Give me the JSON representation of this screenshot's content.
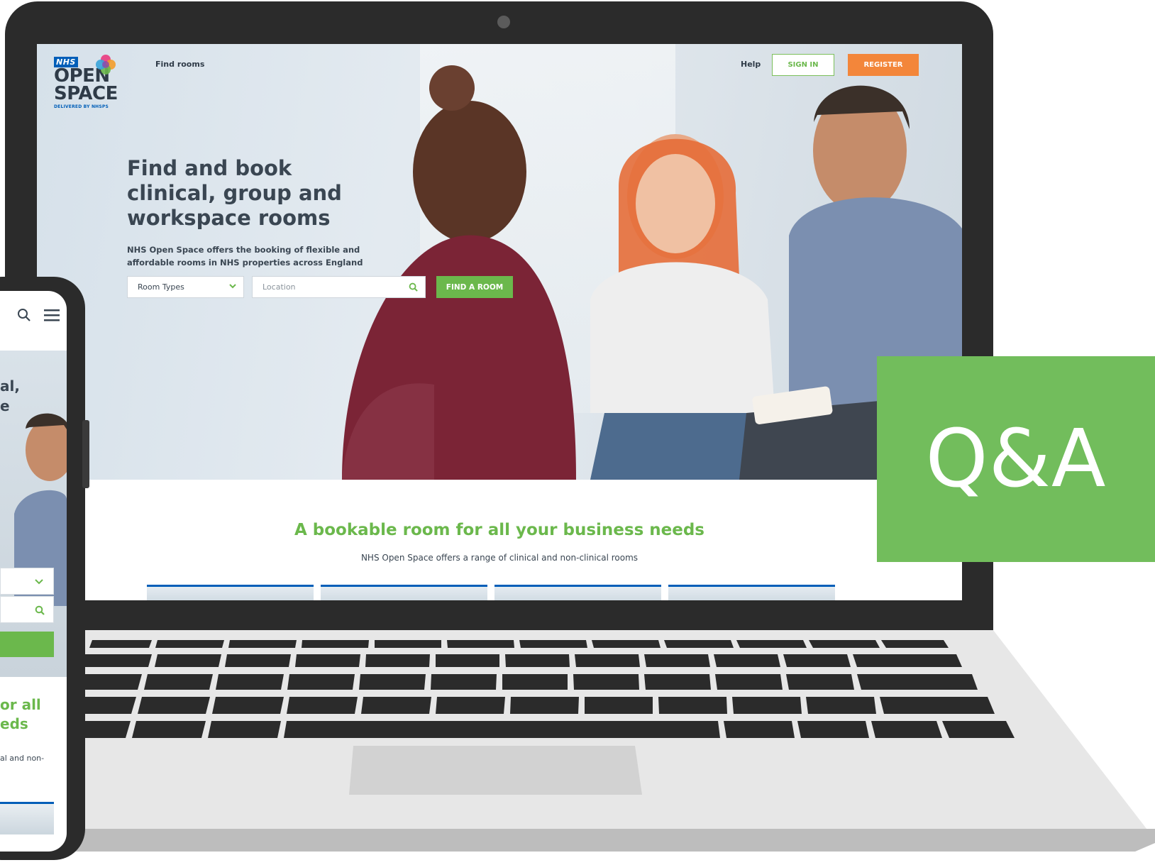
{
  "colors": {
    "nhs_blue": "#005eb8",
    "brand_green": "#6bb84c",
    "register_orange": "#f3863a",
    "qa_green": "#72bd5c",
    "device_dark": "#2b2b2b"
  },
  "logo": {
    "nhs": "NHS",
    "line1": "OPEN",
    "line2": "SPACE",
    "sub": "DELIVERED BY NHSPS"
  },
  "nav": {
    "find_rooms": "Find rooms",
    "help": "Help",
    "sign_in": "SIGN IN",
    "register": "REGISTER"
  },
  "hero": {
    "title": "Find and book clinical, group and workspace rooms",
    "subtitle": "NHS Open Space offers the booking of flexible and affordable rooms in NHS properties across England"
  },
  "search": {
    "room_types_label": "Room Types",
    "location_placeholder": "Location",
    "find_button": "FIND A ROOM"
  },
  "section": {
    "title": "A bookable room for all your business needs",
    "subtitle": "NHS Open Space offers a range of clinical and non-clinical rooms"
  },
  "phone": {
    "hero_line1": "al,",
    "hero_line2": "e",
    "section_line1": "or all",
    "section_line2": "eds",
    "section_sub": "al and non-"
  },
  "overlay": {
    "label": "Q&A"
  },
  "icons": [
    "search-icon",
    "menu-icon",
    "chevron-down-icon"
  ]
}
